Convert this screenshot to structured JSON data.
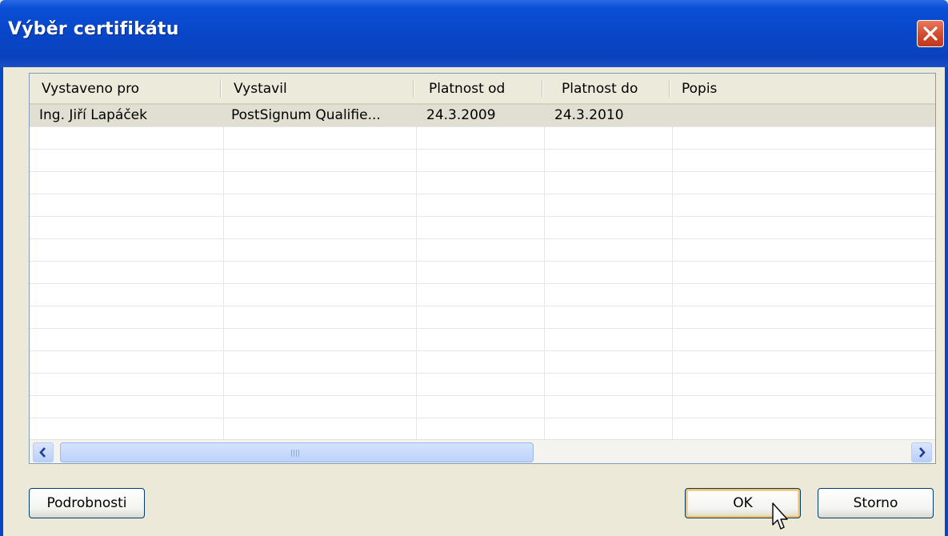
{
  "window": {
    "title": "Výběr certifikátu"
  },
  "list": {
    "columns": [
      "Vystaveno pro",
      "Vystavil",
      "Platnost od",
      "Platnost do",
      "Popis"
    ],
    "rows": [
      {
        "issued_to": "Ing. Jiří Lapáček",
        "issuer": "PostSignum Qualifie...",
        "valid_from": "24.3.2009",
        "valid_to": "24.3.2010",
        "description": ""
      }
    ]
  },
  "scrollbar": {
    "left_icon": "chevron-left-icon",
    "right_icon": "chevron-right-icon",
    "grip_icon": "grip-icon"
  },
  "buttons": {
    "details": "Podrobnosti",
    "ok": "OK",
    "cancel": "Storno"
  },
  "colors": {
    "title_bar": "#0846c8",
    "dialog_bg": "#ece9d8",
    "close_red": "#d0462a",
    "selected_row": "#e0dfd2"
  }
}
